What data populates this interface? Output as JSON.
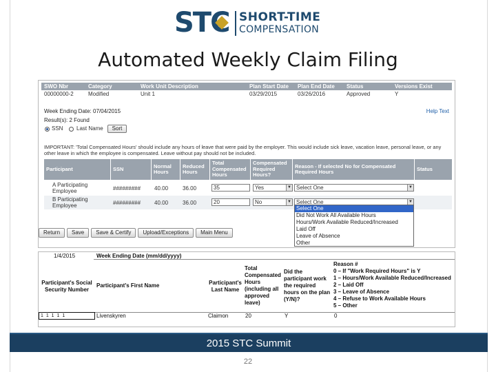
{
  "logo": {
    "mark": "STC",
    "line1": "SHORT-TIME",
    "line2": "COMPENSATION"
  },
  "slide_title": "Automated Weekly Claim Filing",
  "summary_table": {
    "headers": [
      "SWO Nbr",
      "Category",
      "Work Unit Description",
      "Plan Start Date",
      "Plan End Date",
      "Status",
      "Versions Exist"
    ],
    "row": [
      "00000000-2",
      "Modified",
      "Unit 1",
      "03/29/2015",
      "03/26/2016",
      "Approved",
      "Y"
    ]
  },
  "week_ending": "Week Ending Date: 07/04/2015",
  "results": "Result(s): 2 Found",
  "help_text": "Help Text",
  "sort": {
    "option_ssn": "SSN",
    "option_last_name": "Last Name",
    "button": "Sort"
  },
  "important_note": "IMPORTANT: 'Total Compensated Hours' should include any hours of leave that were paid by the employer. This would include sick leave, vacation leave, personal leave, or any other leave in which the employee is compensated. Leave without pay should not be included.",
  "participants_table": {
    "headers": [
      "Participant",
      "SSN",
      "Normal Hours",
      "Reduced Hours",
      "Total Compensated Hours",
      "Compensated Required Hours?",
      "Reason - If selected No for Compensated Required Hours",
      "Status"
    ],
    "rows": [
      {
        "name": "A Participating Employee",
        "ssn": "#########",
        "normal": "40.00",
        "reduced": "36.00",
        "total": "35",
        "required": "Yes",
        "reason": "Select One"
      },
      {
        "name": "B Participating Employee",
        "ssn": "#########",
        "normal": "40.00",
        "reduced": "36.00",
        "total": "20",
        "required": "No",
        "reason": "Select One"
      }
    ]
  },
  "reason_dropdown": [
    "Select One",
    "Did Not Work All Available Hours",
    "Hours/Work Available Reduced/Increased",
    "Laid Off",
    "Leave of Absence",
    "Other"
  ],
  "buttons": [
    "Return",
    "Save",
    "Save & Certify",
    "Upload/Exceptions",
    "Main Menu"
  ],
  "upload_template": {
    "date_value": "1/4/2015",
    "week_ending_header": "Week Ending Date (mm/dd/yyyy)",
    "col_ssn": "Participant's Social Security Number",
    "col_first": "Participant's First Name",
    "col_last": "Participant's Last Name",
    "col_total": "Total Compensated Hours (including all approved leave)",
    "col_required": "Did the participant work the required hours on the plan (Y/N)?",
    "col_reason": "Reason #\n0 – If \"Work Required Hours\" is Y\n1 – Hours/Work Available Reduced/Increased\n2 – Laid Off\n3 – Leave of Absence\n4 – Refuse to Work Available Hours\n5 – Other",
    "row": {
      "ssn": "1 1 1 1 1",
      "first": "Livenskyren",
      "last": "Claimon",
      "total": "20",
      "required": "Y",
      "reason": "0"
    }
  },
  "footer": "2015 STC Summit",
  "page_number": "22"
}
